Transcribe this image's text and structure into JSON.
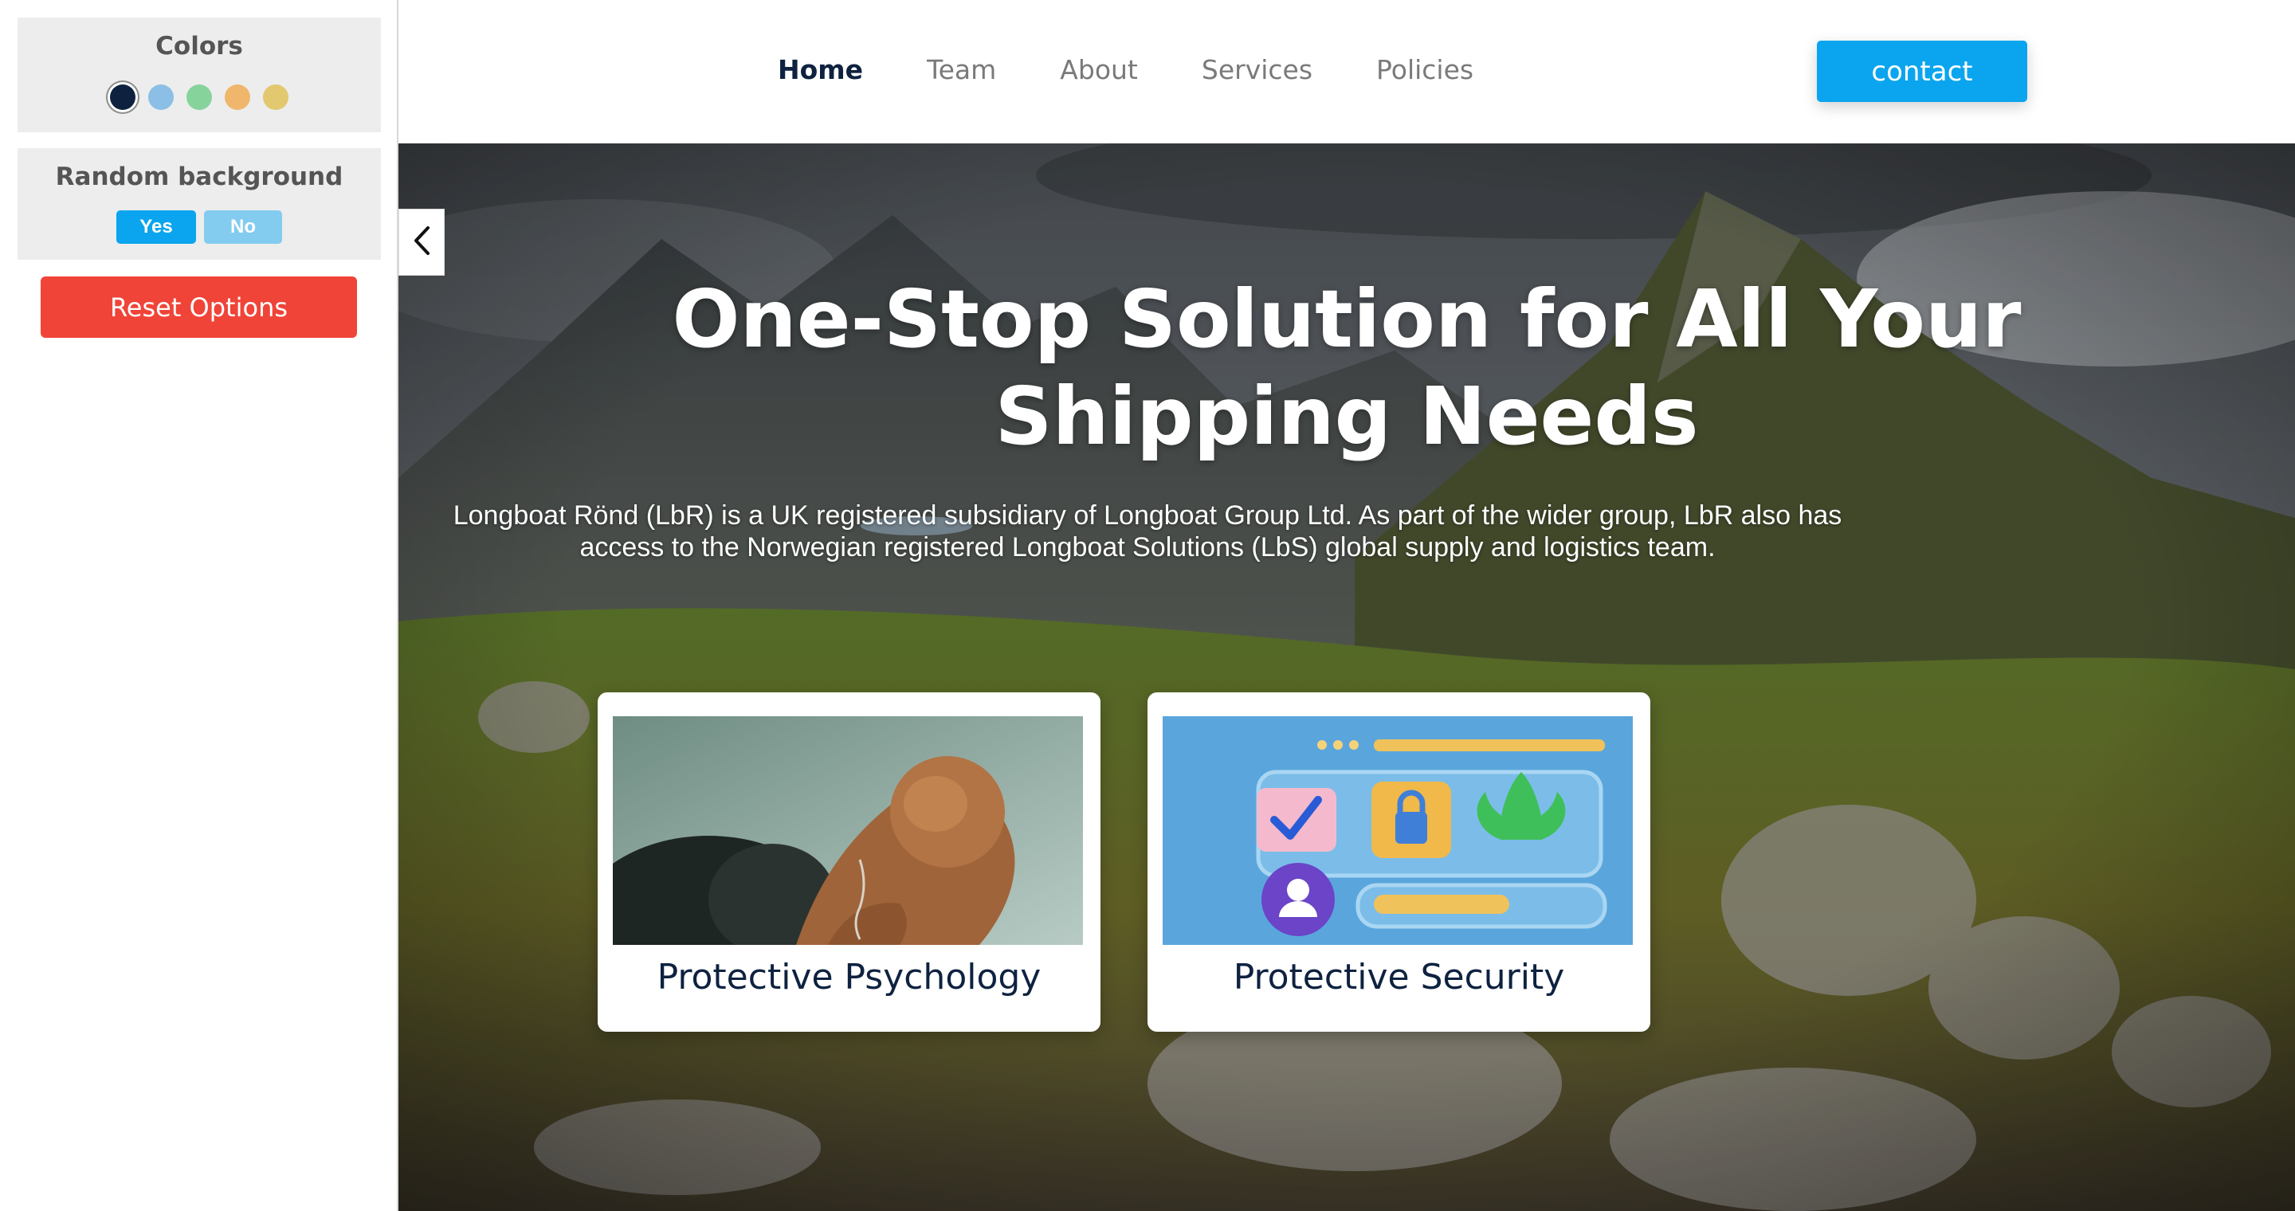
{
  "options": {
    "colors_title": "Colors",
    "swatches": [
      {
        "name": "navy",
        "color": "#0e2240",
        "active": true
      },
      {
        "name": "light-blue",
        "color": "#8bbfe6"
      },
      {
        "name": "green",
        "color": "#86d49c"
      },
      {
        "name": "orange",
        "color": "#f0b66b"
      },
      {
        "name": "yellow",
        "color": "#e2c86e"
      }
    ],
    "random_bg_title": "Random background",
    "yes_label": "Yes",
    "no_label": "No",
    "reset_label": "Reset Options"
  },
  "nav": {
    "links": [
      "Home",
      "Team",
      "About",
      "Services",
      "Policies"
    ],
    "active": "Home",
    "contact_label": "contact"
  },
  "hero": {
    "title_line1": "One-Stop Solution for All Your",
    "title_line2": "Shipping Needs",
    "description": "Longboat Rönd (LbR) is a UK registered subsidiary of Longboat Group Ltd. As part of the wider group, LbR also has access to the Norwegian registered Longboat Solutions (LbS) global supply and logistics team."
  },
  "cards": [
    {
      "title": "Protective Psychology"
    },
    {
      "title": "Protective Security"
    }
  ],
  "colors": {
    "accent": "#0aa5ee",
    "danger": "#f04438",
    "navy": "#0e2240"
  },
  "icons": {
    "panel_toggle": "chevron-left-icon"
  }
}
